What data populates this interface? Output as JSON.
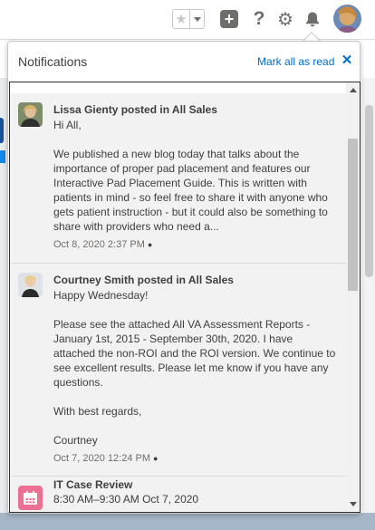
{
  "header": {
    "favorites_icon": "star-icon",
    "favorites_dropdown_icon": "chevron-down-icon",
    "add_icon": "plus-icon",
    "help_icon": "question-icon",
    "settings_icon": "gear-icon",
    "notifications_icon": "bell-icon",
    "add_glyph": "+",
    "help_glyph": "?",
    "settings_glyph": "⚙",
    "star_glyph": "★"
  },
  "panel": {
    "title": "Notifications",
    "mark_all_label": "Mark all as read",
    "close_glyph": "✕"
  },
  "notifications": [
    {
      "title": "Lissa Gienty posted in All Sales",
      "greeting": "Hi All,",
      "body": "We published a new blog today that talks about the importance of proper pad placement and features our Interactive Pad Placement Guide. This is written with patients in mind - so feel free to share it with anyone who gets patient instruction - but it could also be something to share with providers who need a...",
      "time": "Oct 8, 2020 2:37 PM",
      "unread_dot": "●"
    },
    {
      "title": "Courtney Smith posted in All Sales",
      "greeting": "Happy Wednesday!",
      "body": "Please see the attached All VA Assessment Reports - January 1st, 2015 - September 30th, 2020. I have attached the non-ROI and the ROI version. We continue to see excellent results. Please let me know if you have any questions.",
      "closing": "With best regards,",
      "signature": "Courtney",
      "time": "Oct 7, 2020 12:24 PM",
      "unread_dot": "●"
    },
    {
      "title": "IT Case Review",
      "time": "8:30 AM–9:30 AM Oct 7, 2020",
      "icon": "calendar-icon"
    }
  ],
  "colors": {
    "accent": "#006dcc",
    "calendar_icon_bg": "#eb7092",
    "notification_bg": "#f3f2f2"
  }
}
